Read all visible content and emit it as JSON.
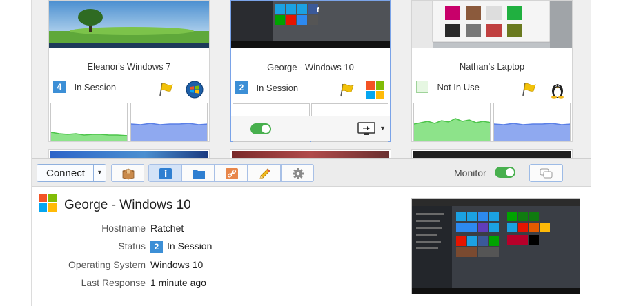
{
  "cards": [
    {
      "name": "Eleanor's Windows 7",
      "session_count": "4",
      "status": "In Session",
      "os": "windows-7-icon"
    },
    {
      "name": "George - Windows 10",
      "session_count": "2",
      "status": "In Session",
      "os": "windows-10-icon"
    },
    {
      "name": "Nathan's Laptop",
      "session_count": "",
      "status": "Not In Use",
      "os": "linux-tux-icon"
    }
  ],
  "toolbar": {
    "connect_label": "Connect",
    "monitor_label": "Monitor"
  },
  "details": {
    "title": "George - Windows 10",
    "fields": [
      {
        "label": "Hostname",
        "value": "Ratchet"
      },
      {
        "label": "Status",
        "badge": "2",
        "value": "In Session"
      },
      {
        "label": "Operating System",
        "value": "Windows 10"
      },
      {
        "label": "Last Response",
        "value": "1 minute ago"
      }
    ]
  },
  "colors": {
    "accent_blue": "#3c8fd6",
    "selection_border": "#7aa3e8",
    "toggle_green": "#48b04e",
    "graph_green": "#8de38a",
    "graph_blue": "#8fa9f0",
    "flag_yellow": "#f2c20a"
  }
}
